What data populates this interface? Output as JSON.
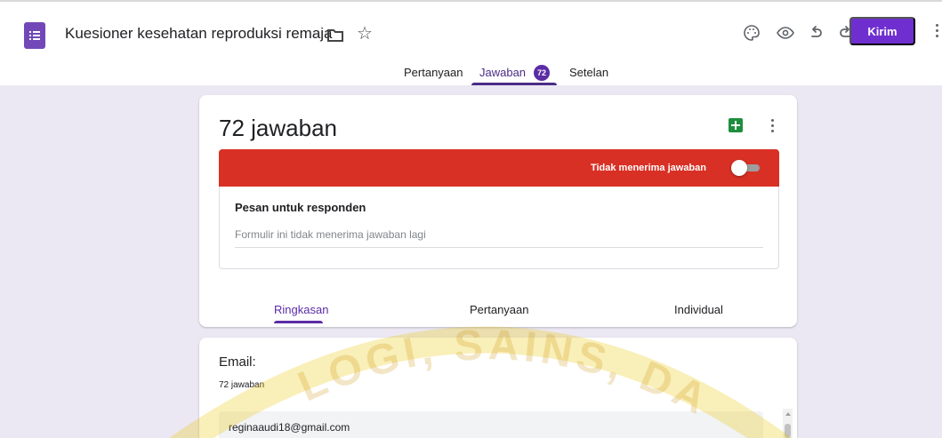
{
  "header": {
    "title": "Kuesioner kesehatan reproduksi remaja",
    "send_label": "Kirim",
    "icons": [
      "forms-logo-icon",
      "folder-icon",
      "star-icon",
      "palette-icon",
      "preview-eye-icon",
      "undo-icon",
      "redo-icon",
      "more-vert-icon"
    ],
    "accent_color": "#6f2fd0"
  },
  "tabs": {
    "questions": "Pertanyaan",
    "responses": "Jawaban",
    "responses_count": "72",
    "settings": "Setelan"
  },
  "summary_card": {
    "count_text": "72 jawaban",
    "banner_label": "Tidak menerima jawaban",
    "banner_color": "#d93025",
    "message_title": "Pesan untuk responden",
    "message_value": "Formulir ini tidak menerima jawaban lagi",
    "section_tabs": [
      "Ringkasan",
      "Pertanyaan",
      "Individual"
    ]
  },
  "email_card": {
    "label": "Email:",
    "count": "72 jawaban",
    "first_value": "reginaaudi18@gmail.com"
  },
  "watermark": {
    "text": "LOGI, SAINS, DA"
  }
}
